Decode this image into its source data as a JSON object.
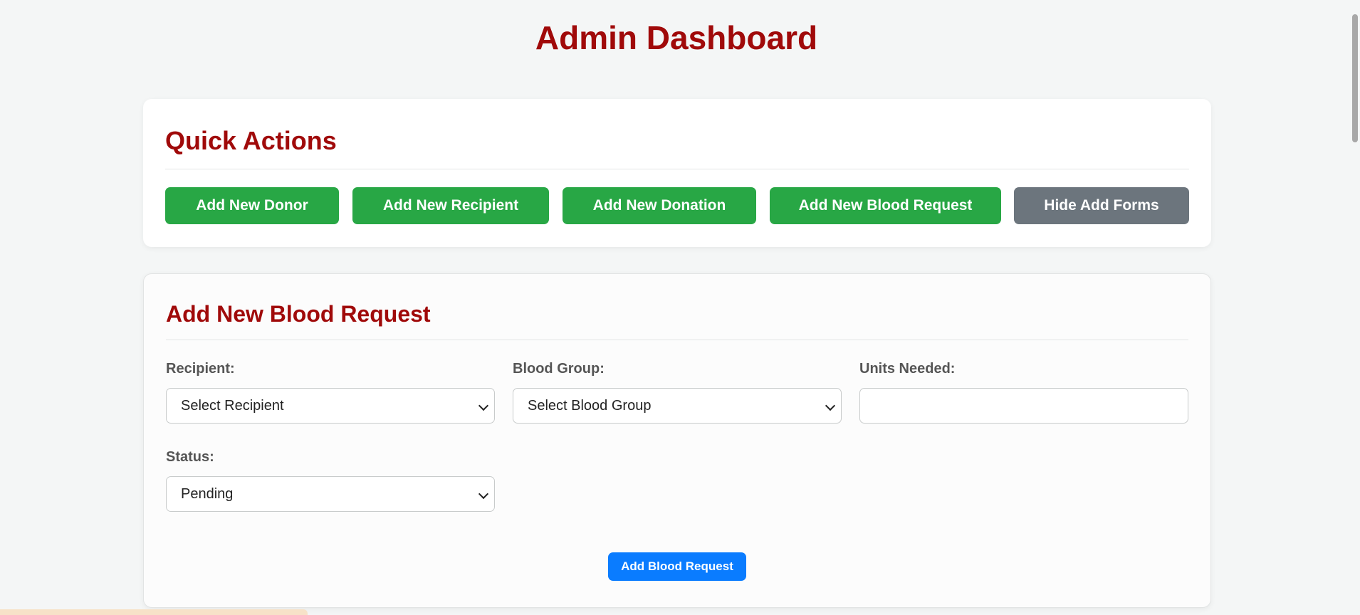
{
  "page": {
    "title": "Admin Dashboard"
  },
  "quick_actions": {
    "heading": "Quick Actions",
    "buttons": [
      {
        "label": "Add New Donor",
        "color": "#28a745"
      },
      {
        "label": "Add New Recipient",
        "color": "#28a745"
      },
      {
        "label": "Add New Donation",
        "color": "#28a745"
      },
      {
        "label": "Add New Blood Request",
        "color": "#28a745"
      },
      {
        "label": "Hide Add Forms",
        "color": "#6c757d"
      }
    ]
  },
  "blood_request_form": {
    "heading": "Add New Blood Request",
    "recipient": {
      "label": "Recipient:",
      "selected": "Select Recipient"
    },
    "blood_group": {
      "label": "Blood Group:",
      "selected": "Select Blood Group"
    },
    "units_needed": {
      "label": "Units Needed:",
      "value": ""
    },
    "status": {
      "label": "Status:",
      "selected": "Pending"
    },
    "submit_label": "Add Blood Request"
  },
  "colors": {
    "heading": "#a00a0a",
    "primary": "#0a7cff",
    "success": "#28a745",
    "secondary": "#6c757d"
  }
}
